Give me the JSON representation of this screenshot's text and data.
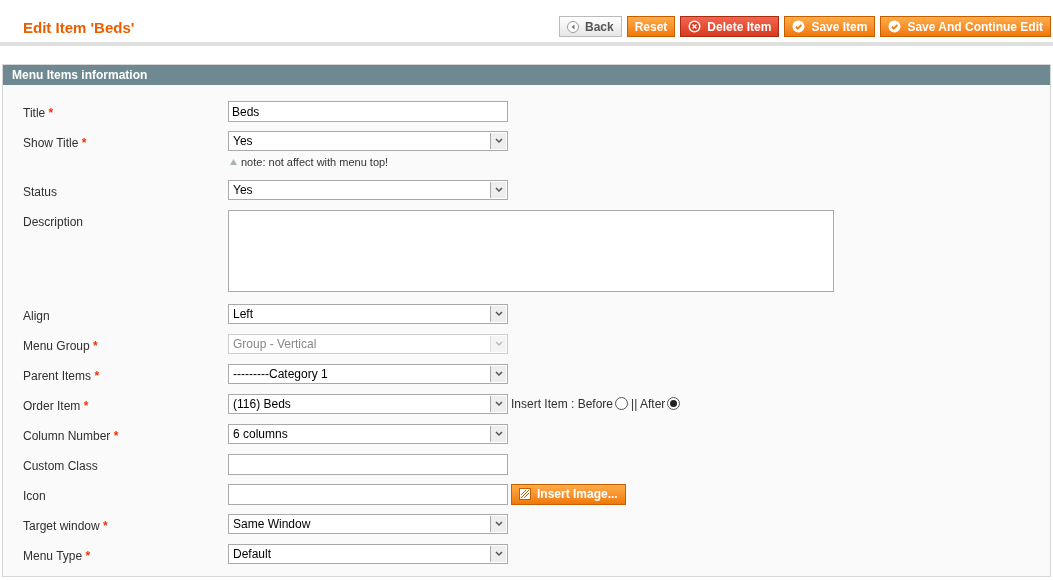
{
  "page_title": "Edit Item 'Beds'",
  "buttons": [
    {
      "label": "Back",
      "kind": "back"
    },
    {
      "label": "Reset",
      "kind": "plain"
    },
    {
      "label": "Delete Item",
      "kind": "delete"
    },
    {
      "label": "Save Item",
      "kind": "save"
    },
    {
      "label": "Save And Continue Edit",
      "kind": "save"
    }
  ],
  "section": {
    "title": "Menu Items information"
  },
  "fields": [
    {
      "label": "Title",
      "mark": "*",
      "kind": "text",
      "value": "Beds"
    },
    {
      "label": "Show Title",
      "mark": "*",
      "kind": "select",
      "value": "Yes",
      "disabled": false,
      "note": "note: not affect with menu top!"
    },
    {
      "label": "Status",
      "kind": "select",
      "value": "Yes",
      "disabled": false
    },
    {
      "label": "Description",
      "kind": "textarea"
    },
    {
      "label": "Align",
      "kind": "select",
      "value": "Left",
      "disabled": false
    },
    {
      "label": "Menu Group",
      "mark": "*",
      "kind": "select",
      "value": "Group - Vertical",
      "disabled": true
    },
    {
      "label": "Parent Items",
      "mark": "*",
      "kind": "select",
      "value": "---------Category 1",
      "disabled": false
    },
    {
      "label": "Order Item",
      "mark": "*",
      "kind": "select",
      "value": "(116) Beds",
      "disabled": false,
      "extra_label": "Insert Item : ",
      "radios": [
        {
          "label": "Before",
          "selected": false
        },
        {
          "label": "|| After",
          "selected": true
        }
      ]
    },
    {
      "label": "Column Number",
      "mark": "*",
      "kind": "select",
      "value": "6 columns",
      "disabled": false
    },
    {
      "label": "Custom Class",
      "kind": "text"
    },
    {
      "label": "Icon",
      "kind": "image",
      "button": "Insert Image..."
    },
    {
      "label": "Target window",
      "mark": "*",
      "kind": "select",
      "value": "Same Window",
      "disabled": false
    },
    {
      "label": "Menu Type",
      "mark": "*",
      "kind": "select",
      "value": "Default",
      "disabled": false
    }
  ]
}
